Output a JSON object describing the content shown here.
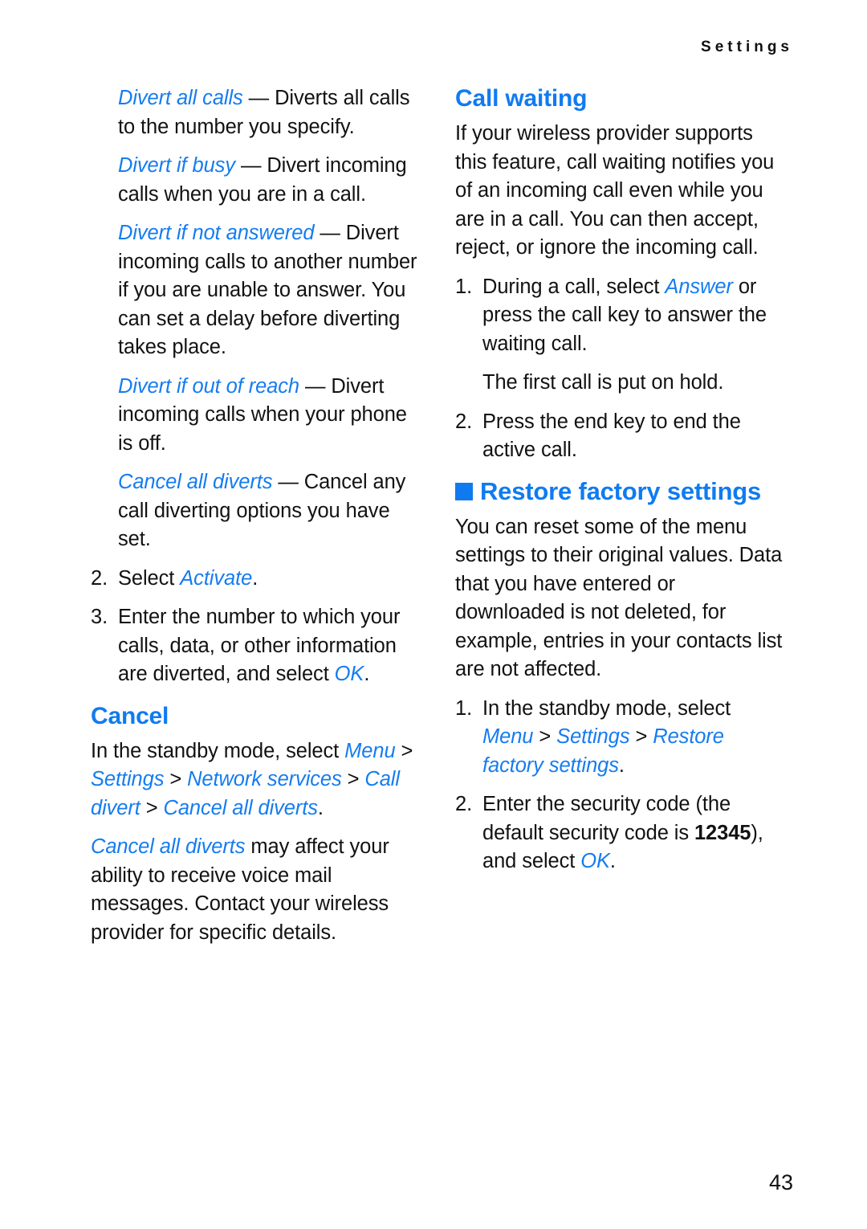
{
  "page": {
    "running_header": "Settings",
    "page_number": "43",
    "accent_color": "#107bf0",
    "text_color": "#121212"
  },
  "left_column": {
    "definitions": [
      {
        "term": "Divert all calls",
        "dash": " — ",
        "description": "Diverts all calls to the number you specify."
      },
      {
        "term": "Divert if busy",
        "dash": " — ",
        "description": "Divert incoming calls when you are in a call."
      },
      {
        "term": "Divert if not answered",
        "dash": " — ",
        "description": "Divert incoming calls to another number if you are unable to answer. You can set a delay before diverting takes place."
      },
      {
        "term": "Divert if out of reach",
        "dash": " — ",
        "description": "Divert incoming calls when your phone is off."
      },
      {
        "term": "Cancel all diverts",
        "dash": " — ",
        "description": "Cancel any call diverting options you have set."
      }
    ],
    "steps": [
      {
        "num": "2.",
        "prefix": "Select ",
        "emphasis": "Activate",
        "suffix": "."
      },
      {
        "num": "3.",
        "prefix": "Enter the number to which your calls, data, or other information are diverted, and select ",
        "emphasis": "OK",
        "suffix": "."
      }
    ],
    "cancel_heading": "Cancel",
    "cancel_path": {
      "lead": "In the standby mode, select ",
      "menu": "Menu",
      "sep1": " > ",
      "settings": "Settings",
      "sep2": " > ",
      "network_services": "Network services",
      "sep3": " > ",
      "call_divert": "Call divert",
      "sep4": " > ",
      "cancel_all_diverts": "Cancel all diverts",
      "end": "."
    },
    "cancel_note": {
      "emphasis": "Cancel all diverts",
      "rest": " may affect your ability to receive voice mail messages. Contact your wireless provider for specific details."
    }
  },
  "right_column": {
    "call_waiting_heading": "Call waiting",
    "call_waiting_intro": "If your wireless provider supports this feature, call waiting notifies you of an incoming call even while you are in a call. You can then accept, reject, or ignore the incoming call.",
    "call_waiting_steps": [
      {
        "num": "1.",
        "prefix": "During a call, select ",
        "emphasis": "Answer",
        "suffix": " or press the call key to answer the waiting call."
      },
      {
        "num": "2.",
        "prefix": "Press the end key to end the active call.",
        "emphasis": "",
        "suffix": ""
      }
    ],
    "call_waiting_note": "The first call is put on hold.",
    "restore_heading": "Restore factory settings",
    "restore_intro": "You can reset some of the menu settings to their original values. Data that you have entered or downloaded is not deleted, for example, entries in your contacts list are not affected.",
    "restore_steps": {
      "step1": {
        "num": "1.",
        "lead": "In the standby mode, select ",
        "menu": "Menu",
        "sep1": " > ",
        "settings": "Settings",
        "sep2": " > ",
        "restore": "Restore factory settings",
        "end": "."
      },
      "step2": {
        "num": "2.",
        "lead": "Enter the security code (the default security code is ",
        "code": "12345",
        "mid": "), and select ",
        "ok": "OK",
        "end": "."
      }
    }
  }
}
